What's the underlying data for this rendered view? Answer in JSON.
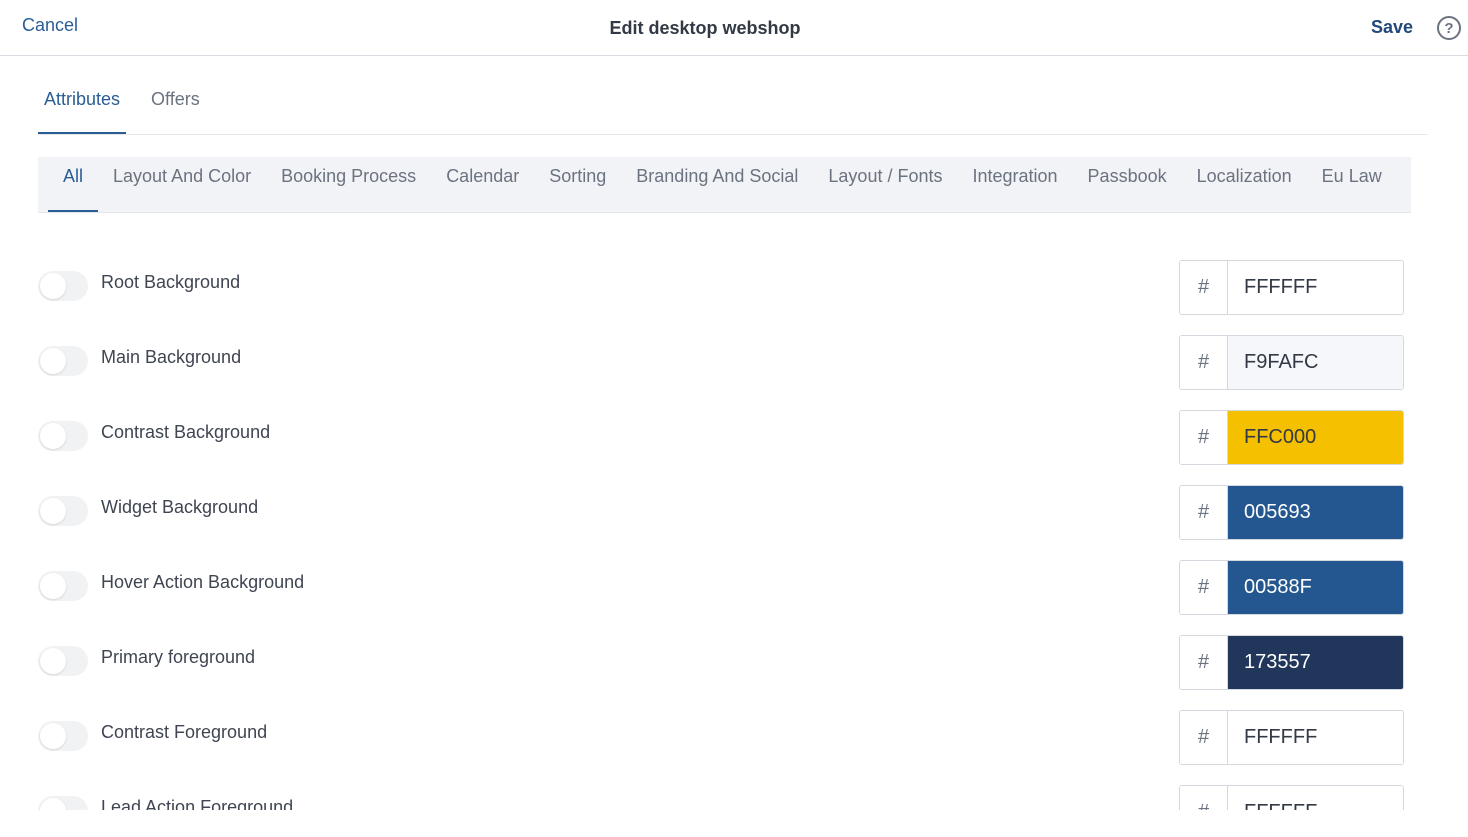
{
  "header": {
    "cancel_label": "Cancel",
    "title": "Edit desktop webshop",
    "save_label": "Save",
    "help_glyph": "?"
  },
  "main_tabs": [
    {
      "label": "Attributes",
      "active": true
    },
    {
      "label": "Offers",
      "active": false
    }
  ],
  "sub_tabs": [
    {
      "label": "All",
      "active": true
    },
    {
      "label": "Layout And Color"
    },
    {
      "label": "Booking Process"
    },
    {
      "label": "Calendar"
    },
    {
      "label": "Sorting"
    },
    {
      "label": "Branding And Social"
    },
    {
      "label": "Layout / Fonts"
    },
    {
      "label": "Integration"
    },
    {
      "label": "Passbook"
    },
    {
      "label": "Localization"
    },
    {
      "label": "Eu Law"
    }
  ],
  "attributes": [
    {
      "label": "Root Background",
      "hash": "#",
      "value": "FFFFFF",
      "swatch": "#ffffff",
      "light_text": false
    },
    {
      "label": "Main Background",
      "hash": "#",
      "value": "F9FAFC",
      "swatch": "#f5f7fa",
      "light_text": false
    },
    {
      "label": "Contrast Background",
      "hash": "#",
      "value": "FFC000",
      "swatch": "#f5c000",
      "light_text": false
    },
    {
      "label": "Widget Background",
      "hash": "#",
      "value": "005693",
      "swatch": "#24578f",
      "light_text": true
    },
    {
      "label": "Hover Action Background",
      "hash": "#",
      "value": "00588F",
      "swatch": "#24578f",
      "light_text": true
    },
    {
      "label": "Primary foreground",
      "hash": "#",
      "value": "173557",
      "swatch": "#20365a",
      "light_text": true
    },
    {
      "label": "Contrast Foreground",
      "hash": "#",
      "value": "FFFFFF",
      "swatch": "#ffffff",
      "light_text": false
    },
    {
      "label": "Lead Action Foreground",
      "hash": "#",
      "value": "FFFFFF",
      "swatch": "#ffffff",
      "light_text": false
    }
  ]
}
